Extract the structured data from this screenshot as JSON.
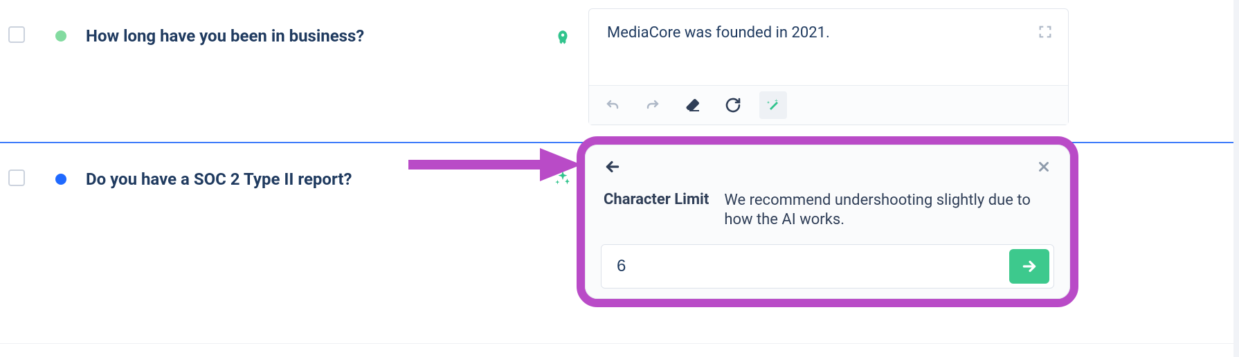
{
  "rows": [
    {
      "label": "How long have you been in business?",
      "dotColor": "green"
    },
    {
      "label": "Do you have a SOC 2 Type II report?",
      "dotColor": "blue"
    }
  ],
  "answer": {
    "text": "MediaCore was founded in 2021."
  },
  "popover": {
    "title": "Character Limit",
    "hint": "We recommend undershooting slightly due to how the AI works.",
    "input_value": "6"
  }
}
